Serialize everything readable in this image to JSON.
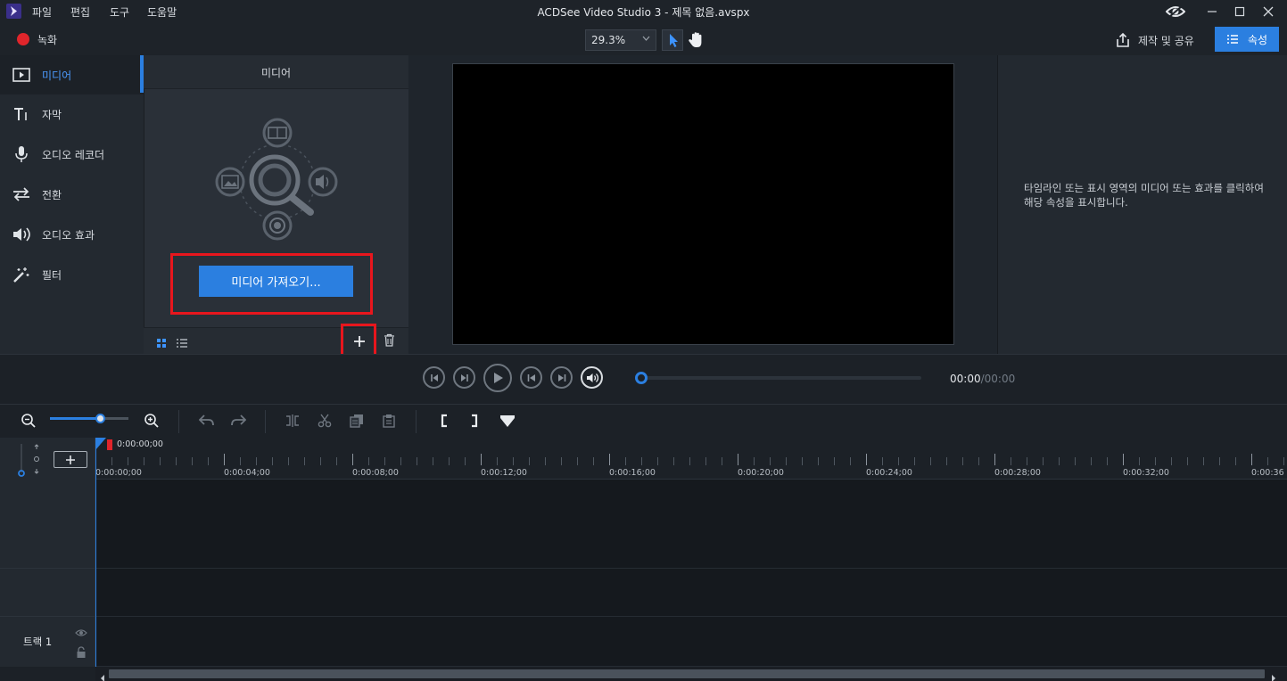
{
  "titlebar": {
    "menus": [
      "파일",
      "편집",
      "도구",
      "도움말"
    ],
    "window_title": "ACDSee Video Studio 3 - 제목 없음.avspx"
  },
  "toolbar": {
    "record_label": "녹화",
    "zoom_value": "29.3%",
    "share_label": "제작 및 공유",
    "properties_label": "속성"
  },
  "nav": {
    "items": [
      {
        "label": "미디어",
        "icon": "play-box-icon"
      },
      {
        "label": "자막",
        "icon": "text-icon"
      },
      {
        "label": "오디오 레코더",
        "icon": "microphone-icon"
      },
      {
        "label": "전환",
        "icon": "transition-arrows-icon"
      },
      {
        "label": "오디오 효과",
        "icon": "speaker-icon"
      },
      {
        "label": "필터",
        "icon": "magic-wand-icon"
      }
    ]
  },
  "media_panel": {
    "title": "미디어",
    "import_button": "미디어 가져오기..."
  },
  "properties_panel": {
    "hint": "타임라인 또는 표시 영역의 미디어 또는 효과를 클릭하여 해당 속성을 표시합니다."
  },
  "playback": {
    "current_time": "00:00",
    "total_time": "/00:00",
    "progress": 0
  },
  "timeline": {
    "playhead_time": "0:00:00;00",
    "ruler_ticks": [
      "0:00:00;00",
      "0:00:04;00",
      "0:00:08;00",
      "0:00:12;00",
      "0:00:16;00",
      "0:00:20;00",
      "0:00:24;00",
      "0:00:28;00",
      "0:00:32;00",
      "0:00:36"
    ],
    "track_label": "트랙 1"
  },
  "colors": {
    "accent": "#2b7fe0",
    "record": "#e0252b",
    "highlight_box": "#e8161d"
  }
}
